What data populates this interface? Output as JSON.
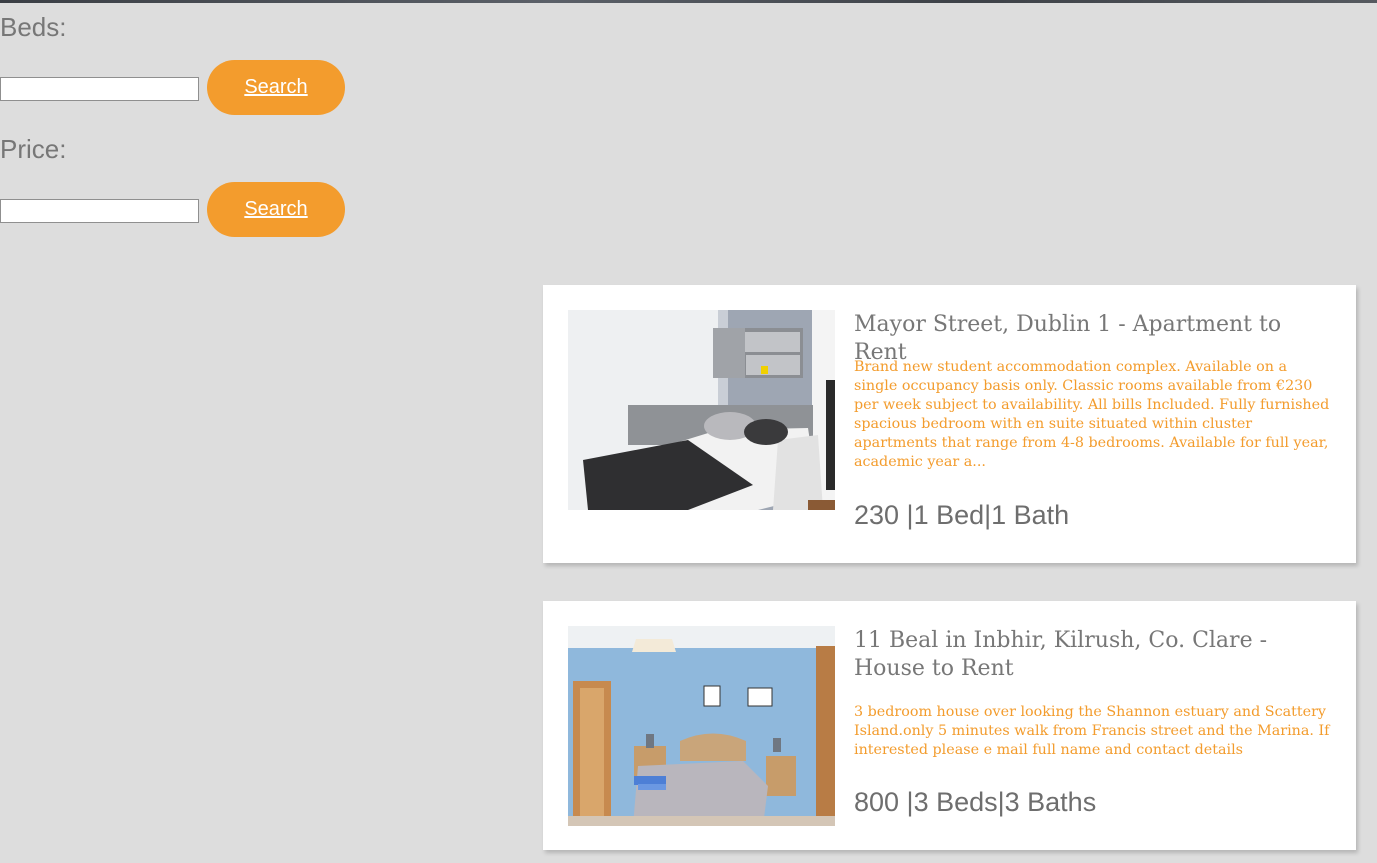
{
  "filters": {
    "beds_label": "Beds:",
    "beds_value": "",
    "beds_button": "Search",
    "price_label": "Price:",
    "price_value": "",
    "price_button": "Search"
  },
  "listings": [
    {
      "title": "Mayor Street, Dublin 1 - Apartment to Rent",
      "description": "Brand new student accommodation complex. Available on a single occupancy basis only. Classic rooms available from €230 per week subject to availability. All bills Included. Fully furnished spacious bedroom with en suite situated within cluster apartments that range from 4-8 bedrooms. Available for full year, academic year a...",
      "meta": "230 |1 Bed|1 Bath"
    },
    {
      "title": "11 Beal in Inbhir, Kilrush, Co. Clare - House to Rent",
      "description": "3 bedroom house over looking the Shannon estuary and Scattery Island.only 5 minutes walk from Francis street and the Marina. If interested please e mail full name and contact details",
      "meta": "800 |3 Beds|3 Baths"
    }
  ],
  "colors": {
    "accent": "#f39c2d",
    "background": "#dddddd",
    "label_grey": "#777777"
  }
}
